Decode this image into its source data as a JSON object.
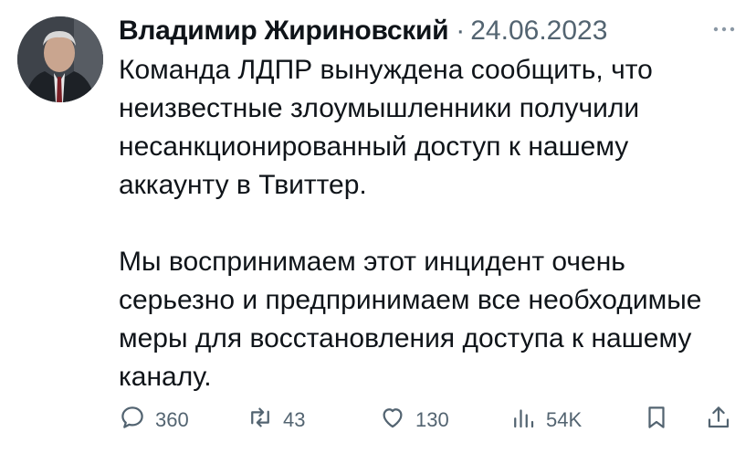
{
  "tweet": {
    "author": "Владимир Жириновский",
    "separator": "·",
    "date": "24.06.2023",
    "paragraphs": [
      "Команда ЛДПР вынуждена сообщить, что неизвестные злоумышленники получили несанкционированный доступ к нашему аккаунту в Твиттер.",
      "Мы воспринимаем этот инцидент очень серьезно и предпринимаем все необходимые меры для восстановления доступа к нашему каналу."
    ]
  },
  "actions": {
    "replies": "360",
    "retweets": "43",
    "likes": "130",
    "views": "54K"
  },
  "icons": {
    "more": "more-icon",
    "reply": "reply-icon",
    "retweet": "retweet-icon",
    "like": "heart-icon",
    "views": "views-icon",
    "bookmark": "bookmark-icon",
    "share": "share-icon"
  },
  "colors": {
    "text": "#0f1419",
    "secondary": "#536471",
    "background": "#ffffff"
  }
}
